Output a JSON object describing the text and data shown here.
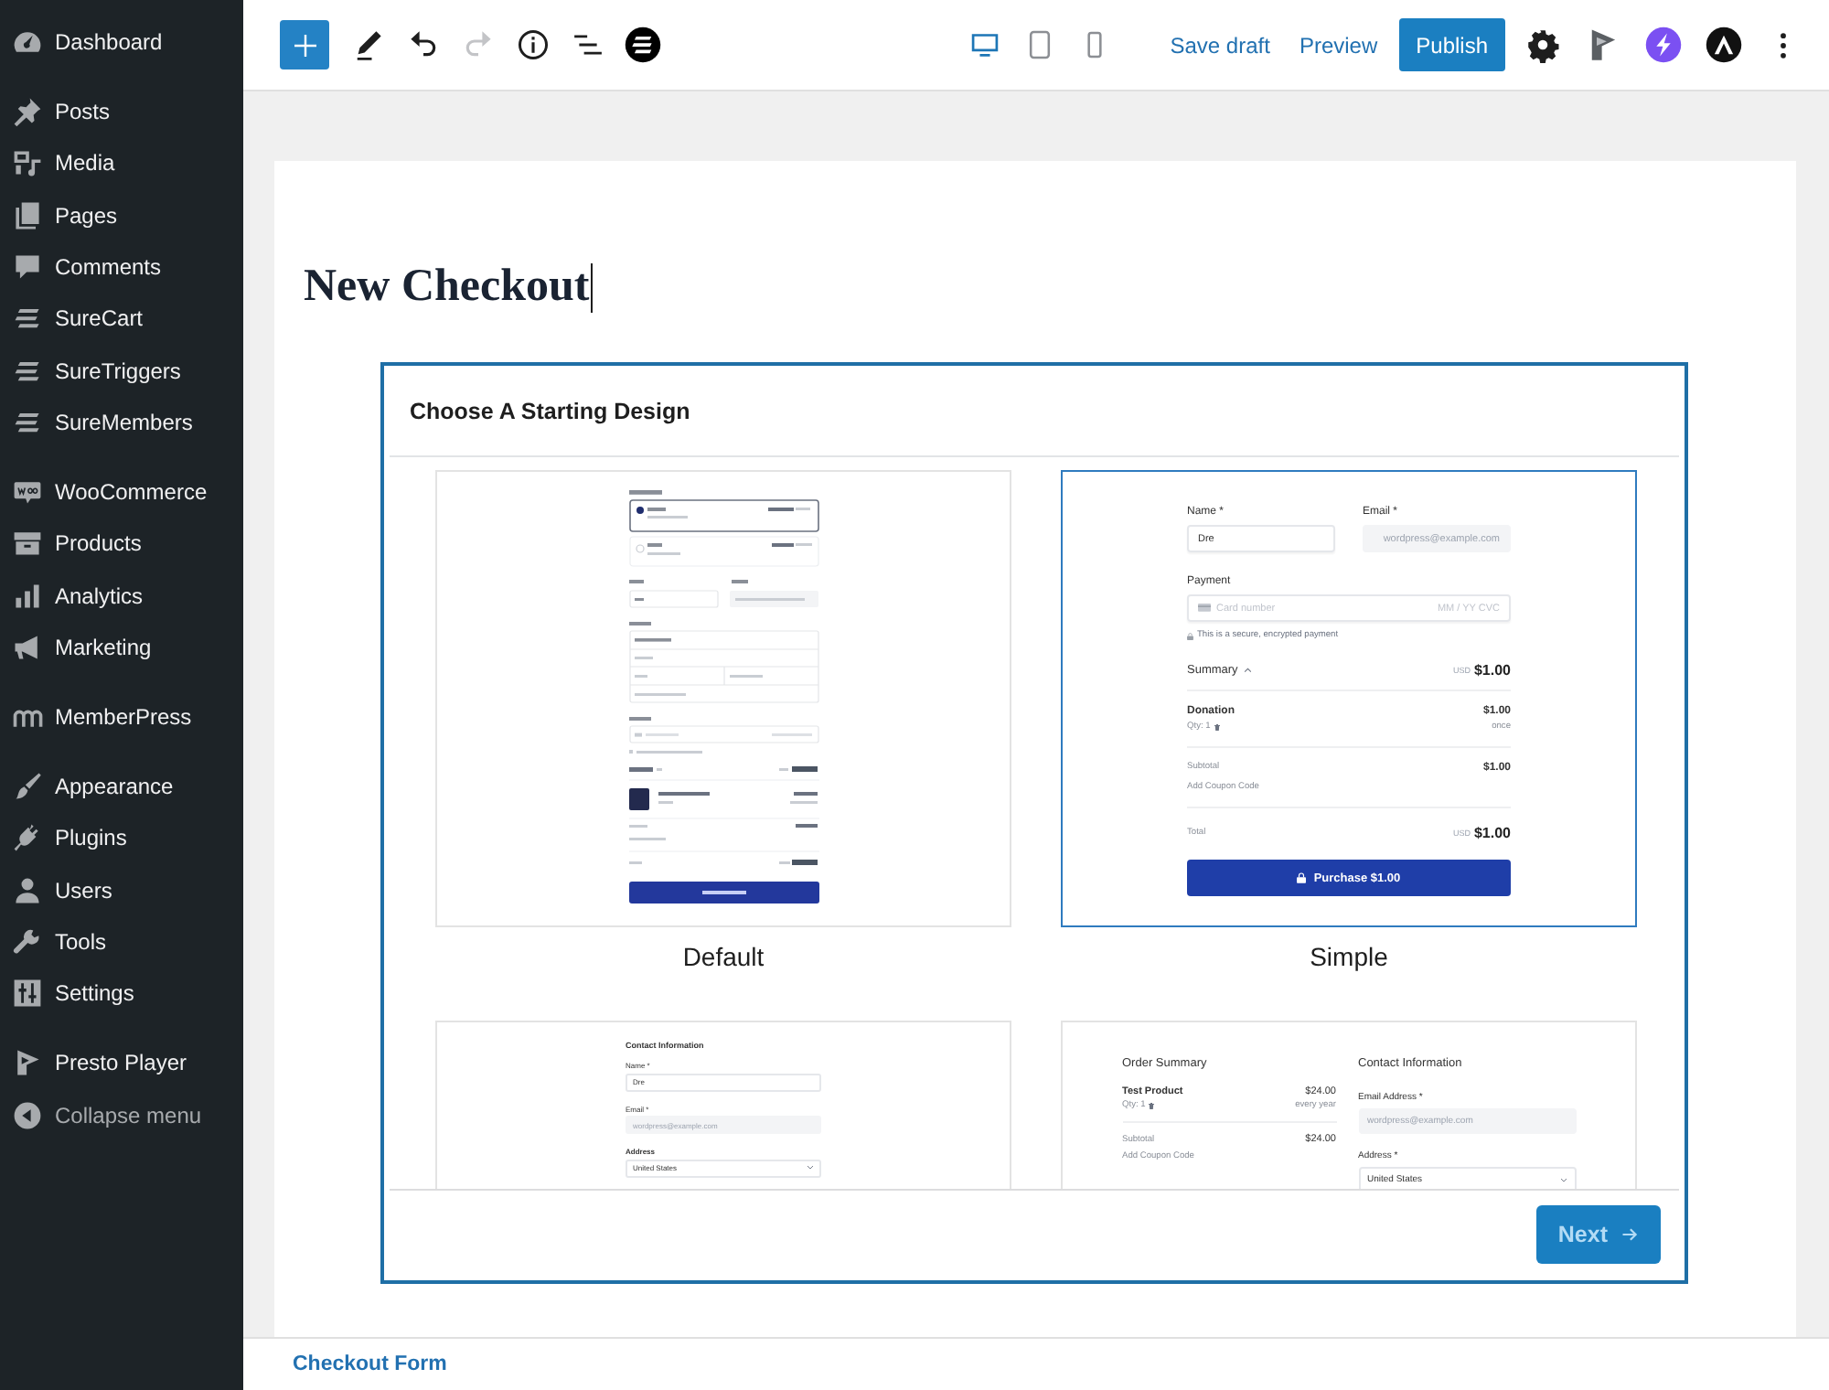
{
  "sidebar": {
    "groups": [
      {
        "items": [
          {
            "label": "Dashboard"
          }
        ]
      },
      {
        "items": [
          {
            "label": "Posts"
          },
          {
            "label": "Media"
          },
          {
            "label": "Pages"
          },
          {
            "label": "Comments"
          },
          {
            "label": "SureCart"
          },
          {
            "label": "SureTriggers"
          },
          {
            "label": "SureMembers"
          }
        ]
      },
      {
        "items": [
          {
            "label": "WooCommerce"
          },
          {
            "label": "Products"
          },
          {
            "label": "Analytics"
          },
          {
            "label": "Marketing"
          }
        ]
      },
      {
        "items": [
          {
            "label": "MemberPress"
          }
        ]
      },
      {
        "items": [
          {
            "label": "Appearance"
          },
          {
            "label": "Plugins"
          },
          {
            "label": "Users"
          },
          {
            "label": "Tools"
          },
          {
            "label": "Settings"
          }
        ]
      },
      {
        "items": [
          {
            "label": "Presto Player"
          }
        ]
      }
    ],
    "collapse_label": "Collapse menu"
  },
  "toolbar": {
    "history": [
      {
        "disabled": false
      },
      {
        "disabled": true
      }
    ],
    "devices": [
      {
        "selected": true
      },
      {
        "selected": false
      },
      {
        "selected": false
      }
    ],
    "save_draft": "Save draft",
    "preview": "Preview",
    "publish": "Publish"
  },
  "editor": {
    "title": "New Checkout",
    "design_picker": {
      "heading": "Choose A Starting Design",
      "designs": [
        {
          "label": "Default",
          "selected": false,
          "preview": {
            "kind": "plan-form"
          }
        },
        {
          "label": "Simple",
          "selected": true,
          "preview": {
            "kind": "simple",
            "name_label": "Name *",
            "name_value": "Dre",
            "email_label": "Email *",
            "email_value": "wordpress@example.com",
            "payment_label": "Payment",
            "card_field": {
              "placeholder": "Card number",
              "date_placeholder": "MM / YY CVC"
            },
            "secure_note": "This is a secure, encrypted payment",
            "summary_label": "Summary",
            "summary_currency": "USD",
            "summary_amount": "$1.00",
            "item_name": "Donation",
            "item_price": "$1.00",
            "item_qty": "Qty: 1",
            "item_interval": "once",
            "subtotal_label": "Subtotal",
            "subtotal_amount": "$1.00",
            "coupon_link": "Add Coupon Code",
            "total_label": "Total",
            "total_currency": "USD",
            "total_amount": "$1.00",
            "button": "Purchase $1.00"
          }
        },
        {
          "selected": false,
          "preview": {
            "kind": "contact",
            "heading": "Contact Information",
            "name_label": "Name *",
            "name_value": "Dre",
            "email_label": "Email *",
            "email_value": "wordpress@example.com",
            "address_label": "Address",
            "country": "United States"
          }
        },
        {
          "selected": false,
          "preview": {
            "kind": "two-column",
            "summary_heading": "Order Summary",
            "item_name": "Test Product",
            "item_price": "$24.00",
            "item_qty": "Qty: 1",
            "item_interval": "every year",
            "subtotal_label": "Subtotal",
            "subtotal_amount": "$24.00",
            "coupon_link": "Add Coupon Code",
            "contact_heading": "Contact Information",
            "email_label": "Email Address *",
            "email_value": "wordpress@example.com",
            "address_label": "Address *",
            "country": "United States"
          }
        }
      ],
      "next": "Next"
    }
  },
  "footer": {
    "breadcrumb": "Checkout Form"
  }
}
